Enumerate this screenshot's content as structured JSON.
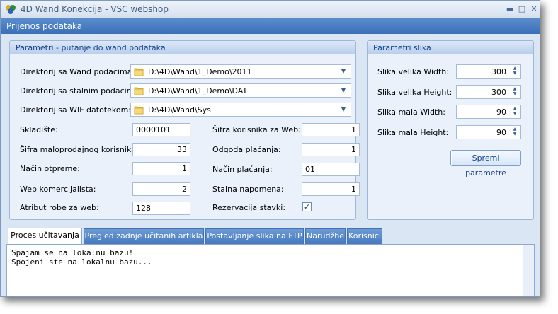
{
  "window": {
    "title": "4D Wand Konekcija - VSC webshop",
    "header": "Prijenos podataka",
    "minimize_glyph": "▬",
    "maximize_glyph": "□",
    "close_glyph": "✕"
  },
  "params_group": {
    "title": "Parametri - putanje do wand podataka",
    "wand_dir_label": "Direktorij sa Wand podacima:",
    "wand_dir_value": "D:\\4D\\Wand\\1_Demo\\2011",
    "static_dir_label": "Direktorij sa stalnim podacima:",
    "static_dir_value": "D:\\4D\\Wand\\1_Demo\\DAT",
    "wif_dir_label": "Direktorij sa WIF datotekom:",
    "wif_dir_value": "D:\\4D\\Wand\\Sys",
    "skladiste_label": "Skladište:",
    "skladiste_value": "0000101",
    "sifra_malo_label": "Šifra maloprodajnog korisnika:",
    "sifra_malo_value": "33",
    "nacin_otpreme_label": "Način otpreme:",
    "nacin_otpreme_value": "1",
    "web_kom_label": "Web komercijalista:",
    "web_kom_value": "2",
    "atribut_label": "Atribut robe za web:",
    "atribut_value": "128",
    "sifra_web_label": "Šifra korisnika za Web:",
    "sifra_web_value": "1",
    "odgoda_label": "Odgoda plaćanja:",
    "odgoda_value": "1",
    "nacin_placanja_label": "Način plaćanja:",
    "nacin_placanja_value": "01",
    "stalna_label": "Stalna napomena:",
    "stalna_value": "1",
    "rezervacija_label": "Rezervacija stavki:",
    "rezervacija_checked": true,
    "check_glyph": "✓"
  },
  "image_group": {
    "title": "Parametri slika",
    "big_w_label": "Slika velika Width:",
    "big_w_value": "300",
    "big_h_label": "Slika velika Height:",
    "big_h_value": "300",
    "small_w_label": "Slika mala Width:",
    "small_w_value": "90",
    "small_h_label": "Slika mala Height:",
    "small_h_value": "90",
    "save_button": "Spremi parametre"
  },
  "tabs": [
    {
      "label": "Proces učitavanja",
      "active": true
    },
    {
      "label": "Pregled zadnje učitanih artikla",
      "active": false
    },
    {
      "label": "Postavljanje slika na FTP",
      "active": false
    },
    {
      "label": "Narudžbe",
      "active": false
    },
    {
      "label": "Korisnici",
      "active": false
    }
  ],
  "log": {
    "lines": [
      "Spajam se na lokalnu bazu!",
      "Spojeni ste na lokalnu bazu..."
    ]
  },
  "colors": {
    "header_blue": "#3a6fb8",
    "group_title": "#15428b",
    "window_bg": "#dbe6f4"
  }
}
